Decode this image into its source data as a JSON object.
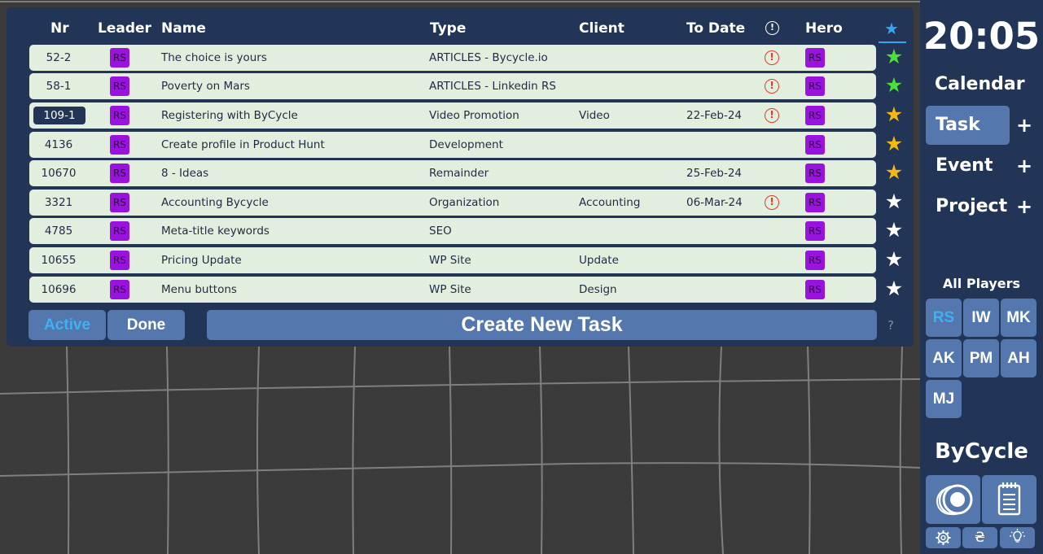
{
  "headers": {
    "nr": "Nr",
    "leader": "Leader",
    "name": "Name",
    "type": "Type",
    "client": "Client",
    "to_date": "To Date",
    "alert": "!",
    "hero": "Hero",
    "star": "★"
  },
  "tasks": [
    {
      "nr": "52-2",
      "leader": "RS",
      "name": "The choice is yours",
      "type": "ARTICLES - Bycycle.io",
      "client": "",
      "to_date": "",
      "alert": "!",
      "hero": "RS",
      "star_color": "#4ee03a"
    },
    {
      "nr": "58-1",
      "leader": "RS",
      "name": "Poverty on Mars",
      "type": "ARTICLES - Linkedin RS",
      "client": "",
      "to_date": "",
      "alert": "!",
      "hero": "RS",
      "star_color": "#4ee03a"
    },
    {
      "nr": "109-1",
      "leader": "RS",
      "name": "Registering with ByCycle",
      "type": "Video Promotion",
      "client": "Video",
      "to_date": "22-Feb-24",
      "alert": "!",
      "hero": "RS",
      "star_color": "#f4b816"
    },
    {
      "nr": "4136",
      "leader": "RS",
      "name": "Create profile in Product Hunt",
      "type": "Development",
      "client": "",
      "to_date": "",
      "alert": "",
      "hero": "RS",
      "star_color": "#f4b816"
    },
    {
      "nr": "10670",
      "leader": "RS",
      "name": "8 - Ideas",
      "type": "Remainder",
      "client": "",
      "to_date": "25-Feb-24",
      "alert": "",
      "hero": "RS",
      "star_color": "#f4b816"
    },
    {
      "nr": "3321",
      "leader": "RS",
      "name": "Accounting Bycycle",
      "type": "Organization",
      "client": "Accounting",
      "to_date": "06-Mar-24",
      "alert": "!",
      "hero": "RS",
      "star_color": "#ffffff"
    },
    {
      "nr": "4785",
      "leader": "RS",
      "name": "Meta-title keywords",
      "type": "SEO",
      "client": "",
      "to_date": "",
      "alert": "",
      "hero": "RS",
      "star_color": "#ffffff"
    },
    {
      "nr": "10655",
      "leader": "RS",
      "name": "Pricing Update",
      "type": "WP Site",
      "client": "Update",
      "to_date": "",
      "alert": "",
      "hero": "RS",
      "star_color": "#ffffff"
    },
    {
      "nr": "10696",
      "leader": "RS",
      "name": "Menu buttons",
      "type": "WP Site",
      "client": "Design",
      "to_date": "",
      "alert": "",
      "hero": "RS",
      "star_color": "#ffffff"
    }
  ],
  "selected_task_nr": "109-1",
  "buttons": {
    "active": "Active",
    "done": "Done",
    "create": "Create New Task",
    "help": "?"
  },
  "sidebar": {
    "clock": "20:05",
    "calendar": "Calendar",
    "task": "Task",
    "event": "Event",
    "project": "Project",
    "plus": "+",
    "players_title": "All Players",
    "players": [
      "RS",
      "IW",
      "MK",
      "AK",
      "PM",
      "AH",
      "MJ"
    ],
    "selected_player": "RS",
    "brand": "ByCycle",
    "currency_symbol": "₴"
  },
  "colors": {
    "panel": "#233556",
    "row_bg": "#e2efdf",
    "badge": "#9a12de",
    "button": "#5478ad",
    "accent_blue": "#3fb0f2",
    "alert_red": "#e33b2a",
    "star_green": "#4ee03a",
    "star_gold": "#f4b816",
    "star_white": "#ffffff"
  }
}
